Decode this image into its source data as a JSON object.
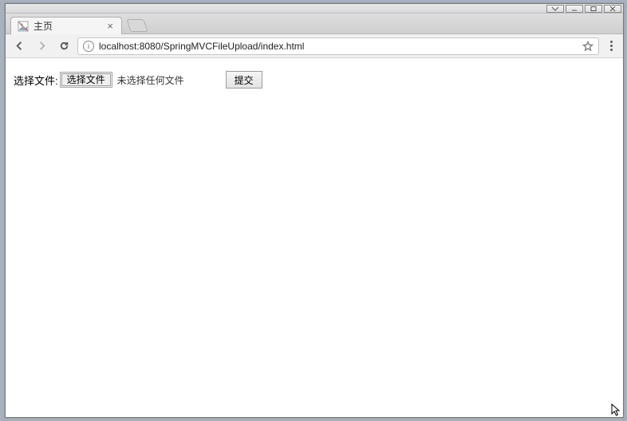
{
  "window": {
    "controls": {
      "dropdown": "▾",
      "minimize": "—",
      "maximize": "□",
      "close": "✕"
    }
  },
  "tab": {
    "title": "主页",
    "close_glyph": "×"
  },
  "toolbar": {
    "info_glyph": "i"
  },
  "address": {
    "value": "localhost:8080/SpringMVCFileUpload/index.html"
  },
  "page": {
    "file_label": "选择文件:",
    "choose_button": "选择文件",
    "no_file_text": "未选择任何文件",
    "submit_label": "提交"
  }
}
